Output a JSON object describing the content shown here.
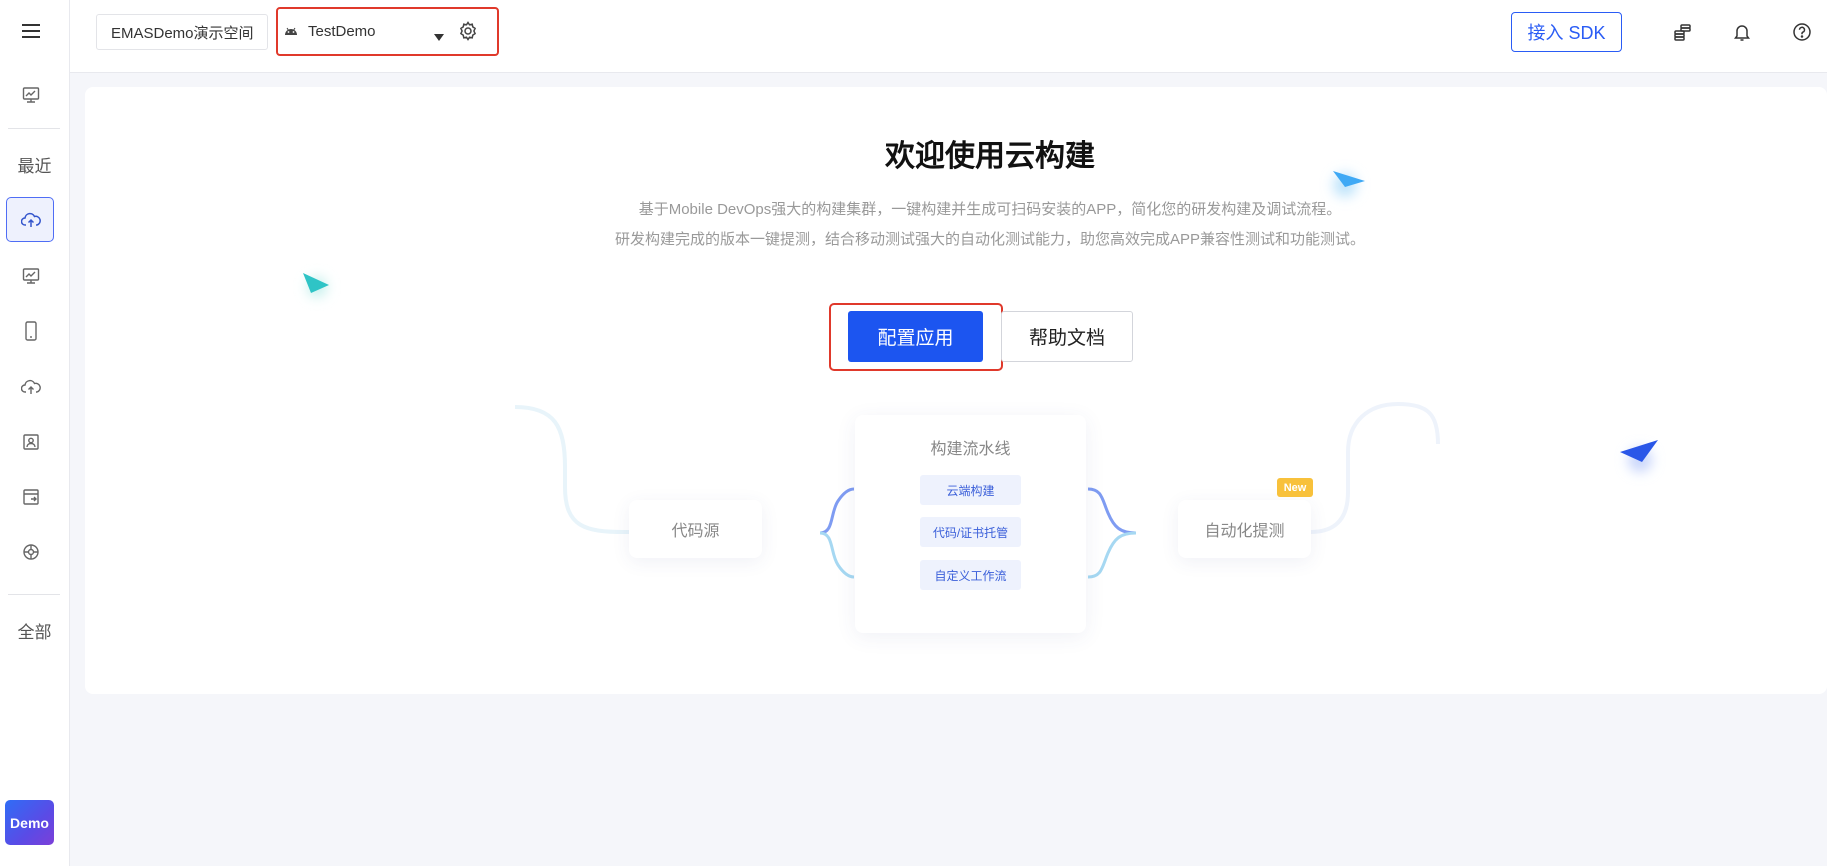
{
  "sidebar": {
    "recent_label": "最近",
    "all_label": "全部",
    "demo_badge": "Demo",
    "icons": [
      "menu-icon",
      "dashboard-icon",
      "cloud-build-icon",
      "monitor-icon",
      "mobile-icon",
      "upload-icon",
      "contacts-icon",
      "card-list-icon",
      "settings-icon"
    ]
  },
  "header": {
    "workspace": "EMASDemo演示空间",
    "app_name": "TestDemo",
    "sdk_button": "接入 SDK",
    "icons": [
      "coins-icon",
      "bell-icon",
      "help-icon"
    ]
  },
  "main": {
    "title": "欢迎使用云构建",
    "desc_line1": "基于Mobile DevOps强大的构建集群，一键构建并生成可扫码安装的APP，简化您的研发构建及调试流程。",
    "desc_line2": "研发构建完成的版本一键提测，结合移动测试强大的自动化测试能力，助您高效完成APP兼容性测试和功能测试。",
    "primary_button": "配置应用",
    "secondary_button": "帮助文档"
  },
  "diagram": {
    "source": "代码源",
    "pipeline_title": "构建流水线",
    "steps": [
      "云端构建",
      "代码/证书托管",
      "自定义工作流"
    ],
    "target": "自动化提测",
    "new_tag": "New"
  },
  "colors": {
    "primary": "#1c55f0",
    "highlight": "#e0392b",
    "new_tag": "#f8c13b"
  }
}
